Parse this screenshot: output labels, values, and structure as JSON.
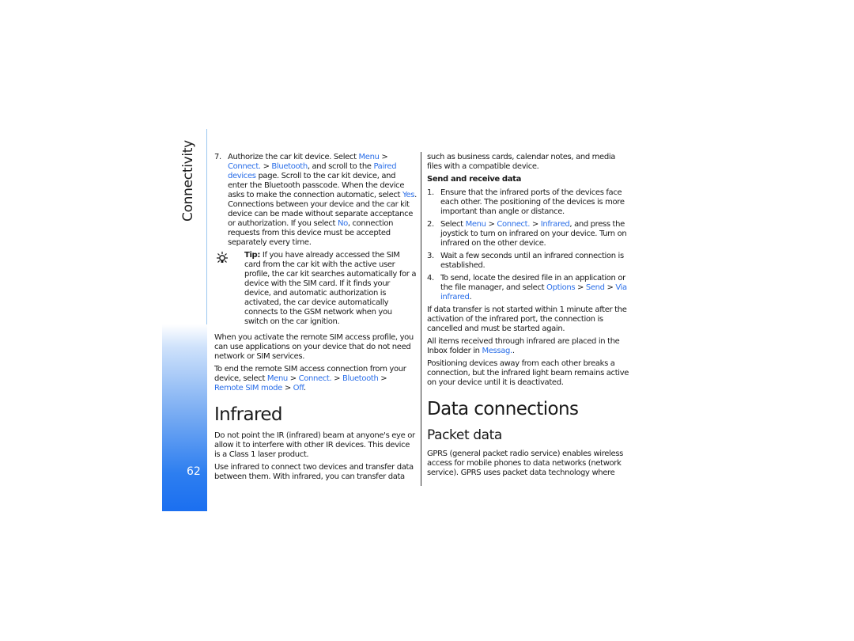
{
  "section": {
    "title": "Connectivity",
    "page_number": "62"
  },
  "col1": {
    "step7": {
      "num": "7.",
      "t1": "Authorize the car kit device. Select ",
      "l1": "Menu",
      "sep1": " > ",
      "l2": "Connect.",
      "sep2": " > ",
      "l3": "Bluetooth",
      "t2": ", and scroll to the ",
      "l4": "Paired devices",
      "t3": " page. Scroll to the car kit device, and enter the Bluetooth passcode. When the device asks to make the connection automatic, select ",
      "l5": "Yes",
      "t4": ". Connections between your device and the car kit device can be made without separate acceptance or authorization. If you select ",
      "l6": "No",
      "t5": ", connection requests from this device must be accepted separately every time."
    },
    "tip": {
      "icon": "lightbulb-icon",
      "label": "Tip:",
      "text": " If you have already accessed the SIM card from the car kit with the active user profile, the car kit searches automatically for a device with the SIM card. If it finds your device, and automatic authorization is activated, the car device automatically connects to the GSM network when you switch on the car ignition."
    },
    "para1": "When you activate the remote SIM access profile, you can use applications on your device that do not need network or SIM services.",
    "para2": {
      "t1": "To end the remote SIM access connection from your device, select ",
      "l1": "Menu",
      "sep1": " > ",
      "l2": "Connect.",
      "sep2": " > ",
      "l3": "Bluetooth",
      "sep3": " > ",
      "l4": "Remote SIM mode",
      "sep4": " > ",
      "l5": "Off",
      "t2": "."
    },
    "infrared_heading": "Infrared",
    "ir_para1": "Do not point the IR (infrared) beam at anyone's eye or allow it to interfere with other IR devices. This device is a Class 1 laser product.",
    "ir_para2": "Use infrared to connect two devices and transfer data between them. With infrared, you can transfer data"
  },
  "col2": {
    "cont": "such as business cards, calendar notes, and media files with a compatible device.",
    "subheading": "Send and receive data",
    "steps": {
      "s1": {
        "num": "1.",
        "text": "Ensure that the infrared ports of the devices face each other. The positioning of the devices is more important than angle or distance."
      },
      "s2": {
        "num": "2.",
        "t1": "Select ",
        "l1": "Menu",
        "sep1": " > ",
        "l2": "Connect.",
        "sep2": " > ",
        "l3": "Infrared",
        "t2": ", and press the joystick to turn on infrared on your device. Turn on infrared on the other device."
      },
      "s3": {
        "num": "3.",
        "text": "Wait a few seconds until an infrared connection is established."
      },
      "s4": {
        "num": "4.",
        "t1": "To send, locate the desired file in an application or the file manager, and select ",
        "l1": "Options",
        "sep1": " > ",
        "l2": "Send",
        "sep2": " > ",
        "l3": "Via infrared",
        "t2": "."
      }
    },
    "para1": "If data transfer is not started within 1 minute after the activation of the infrared port, the connection is cancelled and must be started again.",
    "para2": {
      "t1": "All items received through infrared are placed in the Inbox folder in ",
      "l1": "Messag.",
      "t2": "."
    },
    "para3": "Positioning devices away from each other breaks a connection, but the infrared light beam remains active on your device until it is deactivated.",
    "data_heading": "Data connections",
    "packet_heading": "Packet data",
    "gprs_para": "GPRS (general packet radio service) enables wireless access for mobile phones to data networks (network service). GPRS uses packet data technology where"
  },
  "colors": {
    "link": "#2a6ee8",
    "sidebar": "#1b6ff0"
  }
}
